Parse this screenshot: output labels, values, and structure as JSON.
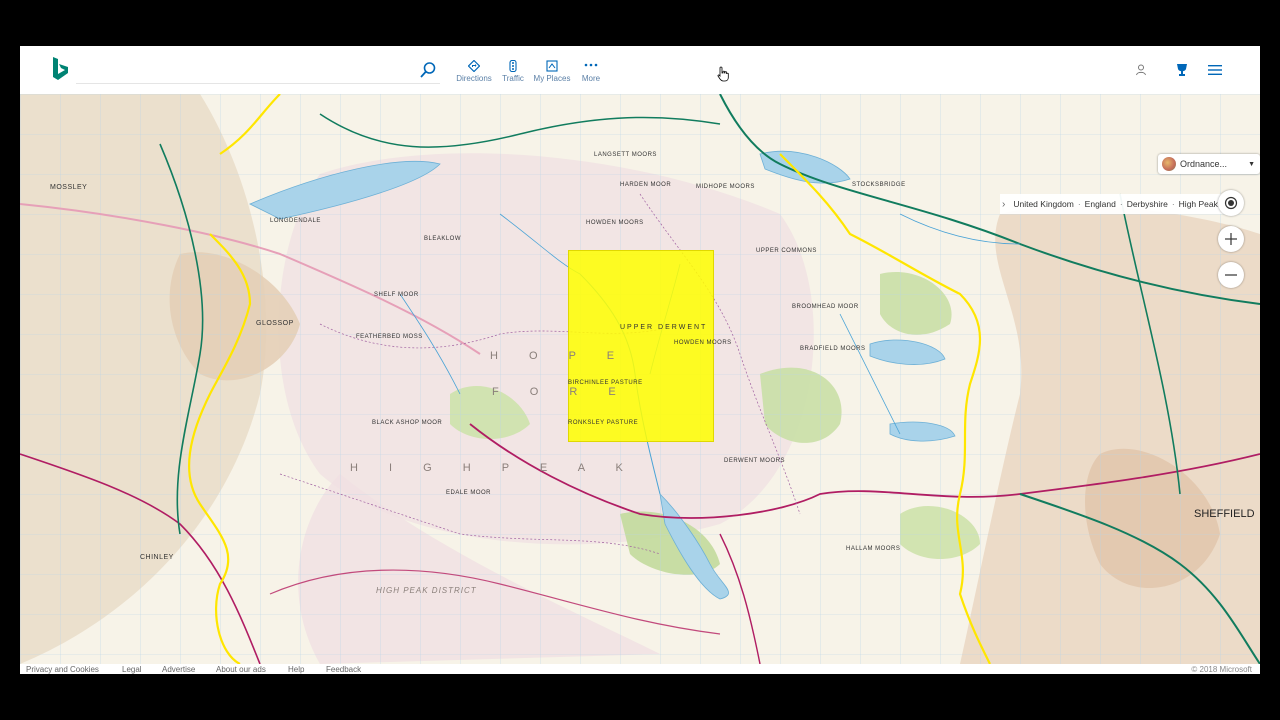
{
  "search": {
    "placeholder": ""
  },
  "nav": {
    "directions": "Directions",
    "traffic": "Traffic",
    "my_places": "My Places",
    "more": "More"
  },
  "map_style": {
    "label": "Ordnance..."
  },
  "breadcrumb": {
    "items": [
      "United Kingdom",
      "England",
      "Derbyshire",
      "High Peak"
    ]
  },
  "map_labels": {
    "sheffield": "SHEFFIELD",
    "hope_forest_1": "H O P E",
    "hope_forest_2": "F O R E",
    "high_peak": "H I G H   P E A K",
    "high_peak_district": "HIGH PEAK DISTRICT",
    "stocksbridge": "STOCKSBRIDGE",
    "langsett_moors": "LANGSETT MOORS",
    "howden_moors": "HOWDEN MOORS",
    "howden_moors_2": "HOWDEN MOORS",
    "upper_commons": "UPPER COMMONS",
    "broomhead_moor": "BROOMHEAD MOOR",
    "bradfield_moors": "BRADFIELD MOORS",
    "derwent_moors": "DERWENT MOORS",
    "hallam_moors": "HALLAM MOORS",
    "birchinlee_pasture": "BIRCHINLEE PASTURE",
    "ronksley_pasture": "RONKSLEY PASTURE",
    "upper_derwent": "UPPER DERWENT",
    "glossop": "GLOSSOP",
    "longdendale": "LONGDENDALE",
    "midhope_moors": "MIDHOPE MOORS",
    "harden_moor": "HARDEN MOOR",
    "black_ashop_moor": "BLACK ASHOP MOOR",
    "edale_moor": "EDALE MOOR",
    "shelf_moor": "SHELF MOOR",
    "bleaklow": "BLEAKLOW",
    "featherbed_moss": "FEATHERBED MOSS",
    "mossley": "MOSSLEY",
    "chinley": "CHINLEY"
  },
  "footer": {
    "privacy": "Privacy and Cookies",
    "legal": "Legal",
    "advertise": "Advertise",
    "about_ads": "About our ads",
    "help": "Help",
    "feedback": "Feedback",
    "copyright": "© 2018 Microsoft"
  },
  "colors": {
    "brand_blue": "#0067b8",
    "highlight": "#ffff00",
    "accent_teal": "#008373"
  },
  "icons": {
    "logo": "bing-logo-icon",
    "search": "search-icon",
    "directions": "directions-icon",
    "traffic": "traffic-icon",
    "my_places": "my-places-icon",
    "more": "more-icon",
    "account": "account-icon",
    "rewards": "rewards-icon",
    "menu": "hamburger-menu-icon",
    "locate": "locate-me-icon",
    "zoom_in": "zoom-in-icon",
    "zoom_out": "zoom-out-icon"
  }
}
